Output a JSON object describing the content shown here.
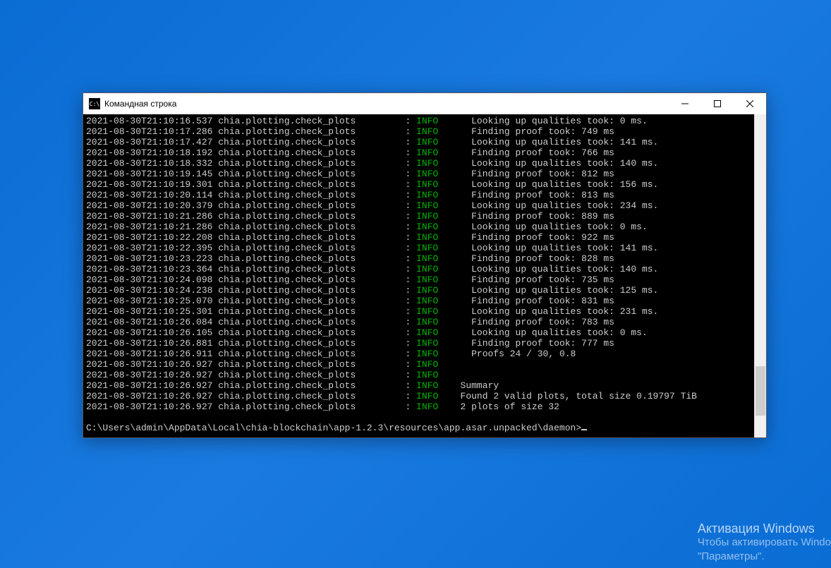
{
  "window": {
    "title": "Командная строка",
    "icon_label": "C:\\"
  },
  "log": {
    "source": "chia.plotting.check_plots",
    "level": "INFO",
    "rows": [
      {
        "ts": "2021-08-30T21:10:16.537",
        "msg": "Looking up qualities took: 0 ms."
      },
      {
        "ts": "2021-08-30T21:10:17.286",
        "msg": "Finding proof took: 749 ms"
      },
      {
        "ts": "2021-08-30T21:10:17.427",
        "msg": "Looking up qualities took: 141 ms."
      },
      {
        "ts": "2021-08-30T21:10:18.192",
        "msg": "Finding proof took: 766 ms"
      },
      {
        "ts": "2021-08-30T21:10:18.332",
        "msg": "Looking up qualities took: 140 ms."
      },
      {
        "ts": "2021-08-30T21:10:19.145",
        "msg": "Finding proof took: 812 ms"
      },
      {
        "ts": "2021-08-30T21:10:19.301",
        "msg": "Looking up qualities took: 156 ms."
      },
      {
        "ts": "2021-08-30T21:10:20.114",
        "msg": "Finding proof took: 813 ms"
      },
      {
        "ts": "2021-08-30T21:10:20.379",
        "msg": "Looking up qualities took: 234 ms."
      },
      {
        "ts": "2021-08-30T21:10:21.286",
        "msg": "Finding proof took: 889 ms"
      },
      {
        "ts": "2021-08-30T21:10:21.286",
        "msg": "Looking up qualities took: 0 ms."
      },
      {
        "ts": "2021-08-30T21:10:22.208",
        "msg": "Finding proof took: 922 ms"
      },
      {
        "ts": "2021-08-30T21:10:22.395",
        "msg": "Looking up qualities took: 141 ms."
      },
      {
        "ts": "2021-08-30T21:10:23.223",
        "msg": "Finding proof took: 828 ms"
      },
      {
        "ts": "2021-08-30T21:10:23.364",
        "msg": "Looking up qualities took: 140 ms."
      },
      {
        "ts": "2021-08-30T21:10:24.098",
        "msg": "Finding proof took: 735 ms"
      },
      {
        "ts": "2021-08-30T21:10:24.238",
        "msg": "Looking up qualities took: 125 ms."
      },
      {
        "ts": "2021-08-30T21:10:25.070",
        "msg": "Finding proof took: 831 ms"
      },
      {
        "ts": "2021-08-30T21:10:25.301",
        "msg": "Looking up qualities took: 231 ms."
      },
      {
        "ts": "2021-08-30T21:10:26.084",
        "msg": "Finding proof took: 783 ms"
      },
      {
        "ts": "2021-08-30T21:10:26.105",
        "msg": "Looking up qualities took: 0 ms."
      },
      {
        "ts": "2021-08-30T21:10:26.881",
        "msg": "Finding proof took: 777 ms"
      },
      {
        "ts": "2021-08-30T21:10:26.911",
        "msg": "Proofs 24 / 30, 0.8",
        "indent": 0
      },
      {
        "ts": "2021-08-30T21:10:26.927",
        "msg": ""
      },
      {
        "ts": "2021-08-30T21:10:26.927",
        "msg": ""
      },
      {
        "ts": "2021-08-30T21:10:26.927",
        "msg": "Summary",
        "indent": -2
      },
      {
        "ts": "2021-08-30T21:10:26.927",
        "msg": "Found 2 valid plots, total size 0.19797 TiB",
        "indent": -2
      },
      {
        "ts": "2021-08-30T21:10:26.927",
        "msg": "2 plots of size 32",
        "indent": -2
      }
    ],
    "ts_width": 24,
    "src_width": 34,
    "msg_pad": 6
  },
  "prompt": "C:\\Users\\admin\\AppData\\Local\\chia-blockchain\\app-1.2.3\\resources\\app.asar.unpacked\\daemon>",
  "watermark": {
    "title": "Активация Windows",
    "line1": "Чтобы активировать Windo",
    "line2": "\"Параметры\"."
  }
}
